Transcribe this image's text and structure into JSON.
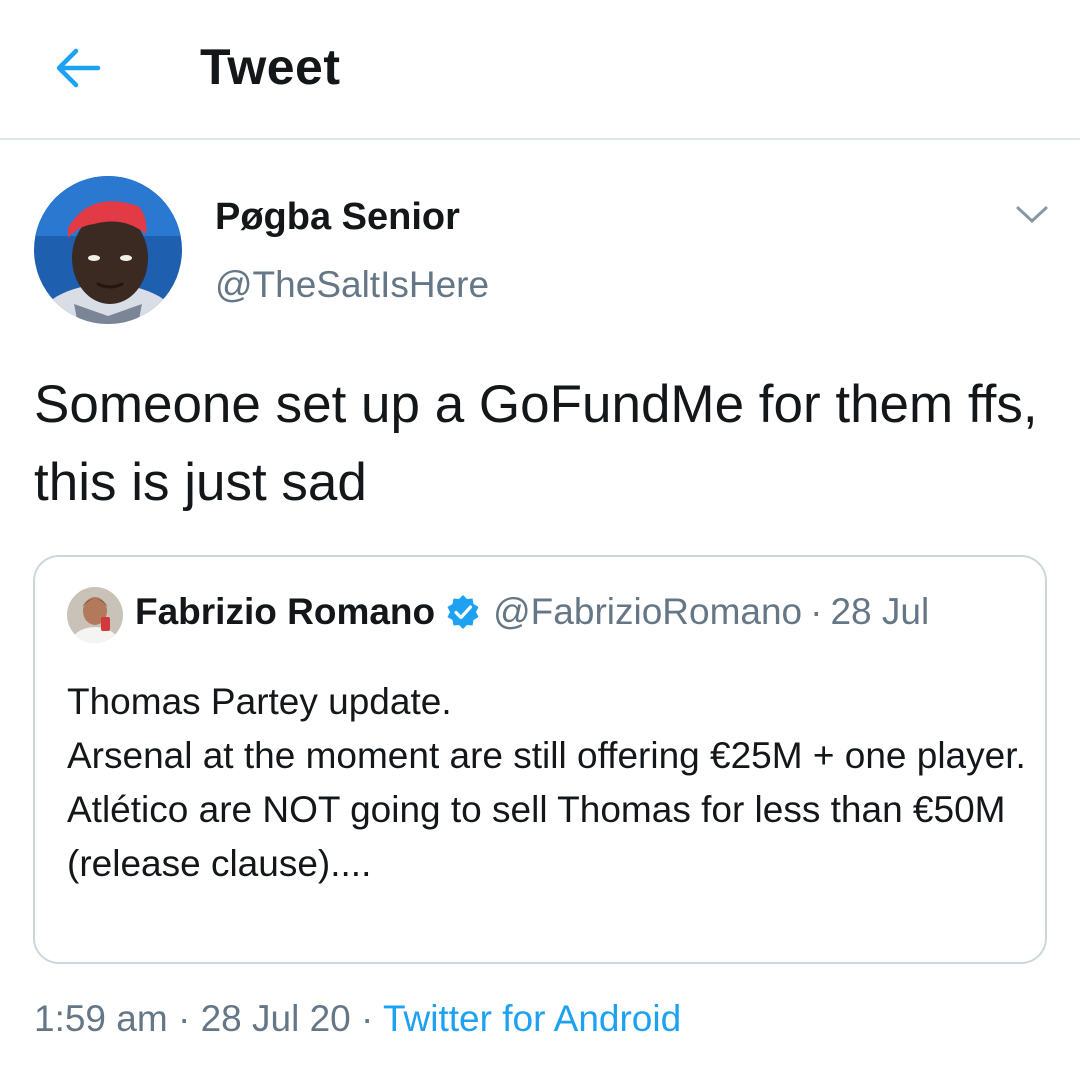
{
  "header": {
    "back_icon": "arrow-left-icon",
    "title": "Tweet"
  },
  "tweet": {
    "display_name": "Pøgba Senior",
    "handle": "@TheSaltIsHere",
    "menu_icon": "chevron-down-icon",
    "text": "Someone set up a GoFundMe for them ffs, this is just sad",
    "time": "1:59 am",
    "date": "28 Jul 20",
    "source": "Twitter for Android",
    "separator": "·"
  },
  "quoted_tweet": {
    "display_name": "Fabrizio Romano",
    "verified_icon": "verified-badge-icon",
    "handle": "@FabrizioRomano",
    "separator": "·",
    "date": "28 Jul",
    "lines": [
      "Thomas Partey update.",
      "Arsenal at the moment are still offering €25M + one player.",
      "Atlético are NOT going to sell Thomas for less than €50M (release clause)...."
    ]
  },
  "colors": {
    "accent": "#1da1f2",
    "text_primary": "#14171a",
    "text_secondary": "#657786",
    "border": "#ccd6dd"
  }
}
